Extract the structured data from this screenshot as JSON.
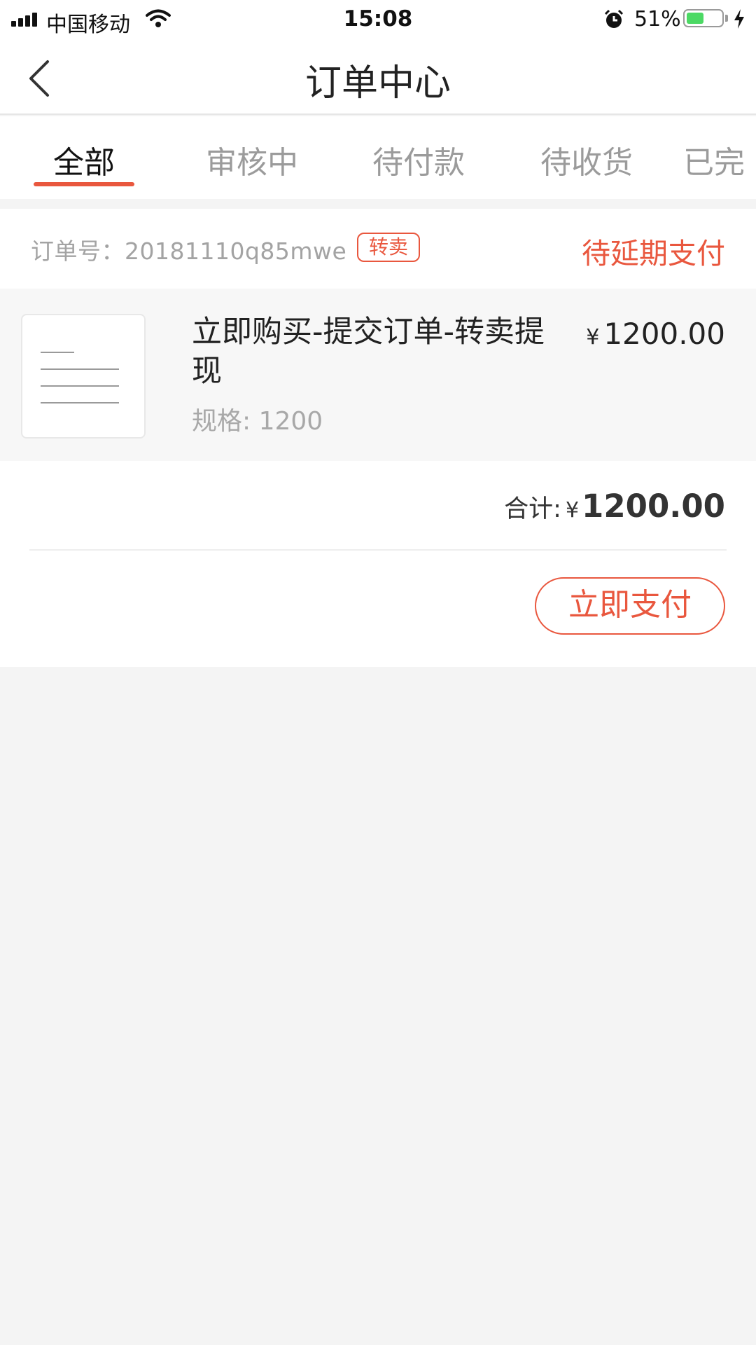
{
  "status_bar": {
    "carrier": "中国移动",
    "time": "15:08",
    "battery_percent": "51%",
    "battery_level": 0.51,
    "icons": [
      "signal-icon",
      "wifi-icon",
      "alarm-icon",
      "battery-icon",
      "charging-icon"
    ]
  },
  "nav": {
    "title": "订单中心",
    "back_icon": "chevron-left-icon"
  },
  "tabs": [
    {
      "label": "全部",
      "active": true
    },
    {
      "label": "审核中",
      "active": false
    },
    {
      "label": "待付款",
      "active": false
    },
    {
      "label": "待收货",
      "active": false
    },
    {
      "label": "已完",
      "active": false
    }
  ],
  "order": {
    "order_no": "订单号：20181110q85mwe",
    "badge": "转卖",
    "status": "待延期支付",
    "product": {
      "title": "立即购买-提交订单-转卖提现",
      "spec": "规格: 1200",
      "currency": "¥",
      "price": "1200.00"
    },
    "total_label": "合计:",
    "total_currency": "¥",
    "total_value": "1200.00",
    "pay_button": "立即支付"
  },
  "colors": {
    "accent": "#e9573e",
    "background": "#f4f4f4",
    "battery": "#4cd964"
  }
}
